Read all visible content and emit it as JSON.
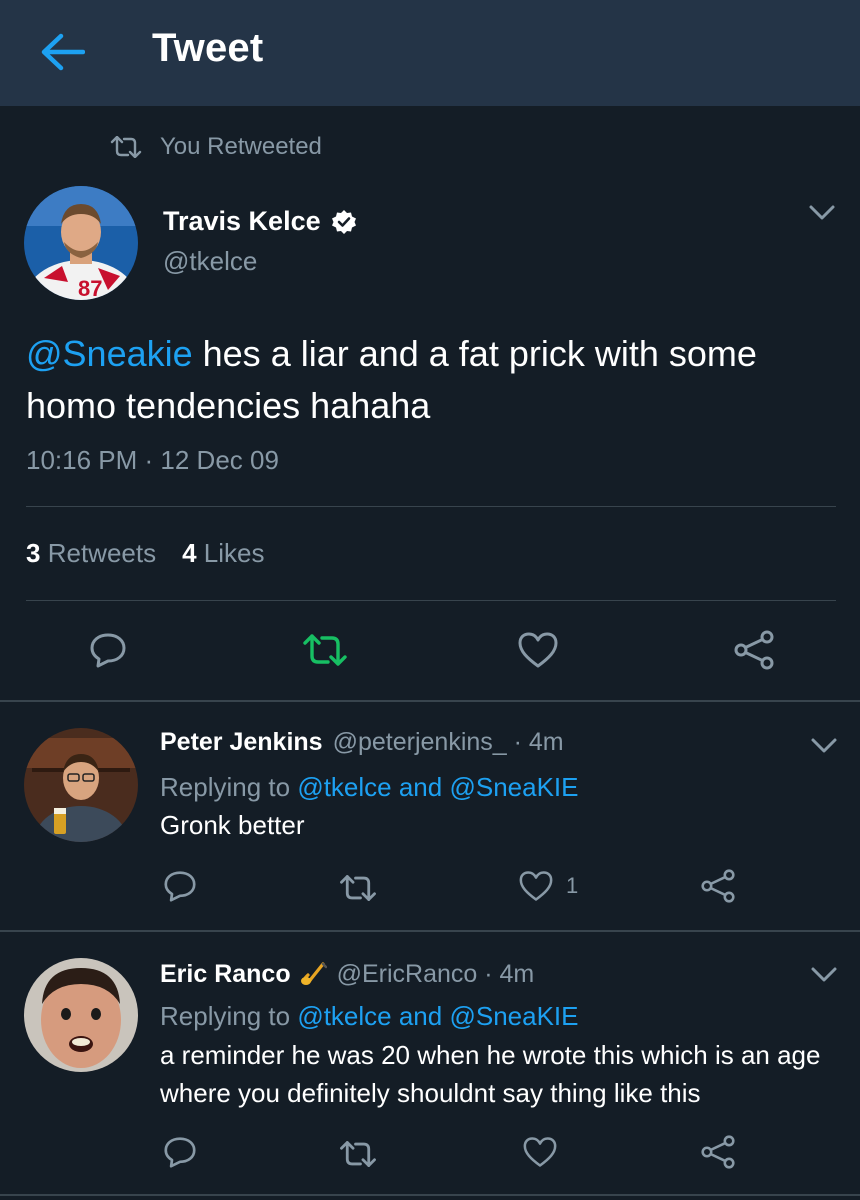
{
  "header": {
    "title": "Tweet"
  },
  "retweet_context": {
    "label": "You Retweeted"
  },
  "tweet": {
    "author_name": "Travis Kelce",
    "author_handle": "@tkelce",
    "mention": "@Sneakie",
    "text": " hes a liar and  a fat prick with some homo tendencies hahaha",
    "timestamp": "10:16 PM · 12 Dec 09",
    "retweets_count": "3",
    "retweets_label": "Retweets",
    "likes_count": "4",
    "likes_label": "Likes"
  },
  "replies": [
    {
      "name": "Peter Jenkins",
      "meta": "@peterjenkins_ · 4m",
      "replying_label": "Replying to ",
      "replying_targets": "@tkelce and @SneaKIE",
      "text": "Gronk better",
      "like_count": "1"
    },
    {
      "name": "Eric Ranco",
      "meta": "@EricRanco · 4m",
      "replying_label": "Replying to ",
      "replying_targets": "@tkelce and @SneaKIE",
      "text": "a reminder he was 20 when he wrote this which is an age where you definitely shouldnt say thing like this",
      "like_count": ""
    }
  ],
  "colors": {
    "background": "#141d26",
    "header": "#243447",
    "accent": "#1da1f2",
    "retweet_active": "#17bf63",
    "muted": "#8899a6",
    "divider": "#38444d"
  },
  "icons": [
    "back-arrow-icon",
    "retweet-icon",
    "verified-badge-icon",
    "chevron-down-icon",
    "reply-icon",
    "like-icon",
    "share-icon",
    "saxophone-emoji-icon"
  ]
}
